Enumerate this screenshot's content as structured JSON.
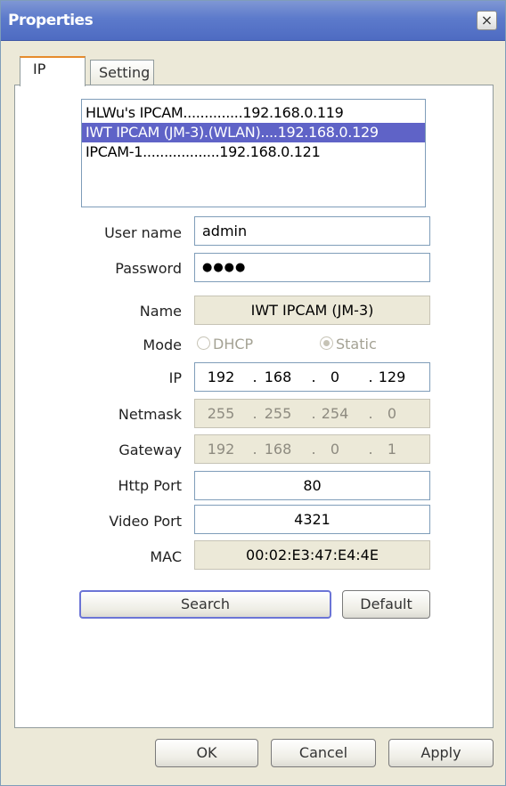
{
  "window": {
    "title": "Properties",
    "close_glyph": "×"
  },
  "tabs": [
    {
      "label": "IP",
      "active": true
    },
    {
      "label": "Setting",
      "active": false
    }
  ],
  "devices": [
    {
      "label": "HLWu's IPCAM..............192.168.0.119",
      "selected": false
    },
    {
      "label": "IWT IPCAM (JM-3).(WLAN)....192.168.0.129",
      "selected": true
    },
    {
      "label": "IPCAM-1..................192.168.0.121",
      "selected": false
    }
  ],
  "form": {
    "username_label": "User name",
    "username_value": "admin",
    "password_label": "Password",
    "password_value": "●●●●",
    "name_label": "Name",
    "name_value": "IWT IPCAM (JM-3)",
    "mode_label": "Mode",
    "mode_dhcp": "DHCP",
    "mode_static": "Static",
    "mode_selected": "Static",
    "ip_label": "IP",
    "ip": [
      "192",
      "168",
      "0",
      "129"
    ],
    "netmask_label": "Netmask",
    "netmask": [
      "255",
      "255",
      "254",
      "0"
    ],
    "gateway_label": "Gateway",
    "gateway": [
      "192",
      "168",
      "0",
      "1"
    ],
    "http_port_label": "Http Port",
    "http_port_value": "80",
    "video_port_label": "Video Port",
    "video_port_value": "4321",
    "mac_label": "MAC",
    "mac_value": "00:02:E3:47:E4:4E",
    "dot": "."
  },
  "buttons": {
    "search": "Search",
    "default": "Default",
    "ok": "OK",
    "cancel": "Cancel",
    "apply": "Apply"
  },
  "colors": {
    "titlebar": "#5c7acb",
    "selection": "#5f63c7",
    "face": "#ece9d8"
  }
}
